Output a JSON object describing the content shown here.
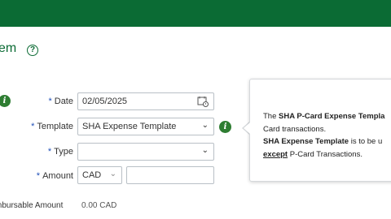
{
  "header": {
    "color": "#0b6b34"
  },
  "page": {
    "title": "em",
    "help_icon": "?"
  },
  "form": {
    "info_icon": "i",
    "date": {
      "required": "*",
      "label": "Date",
      "value": "02/05/2025"
    },
    "template": {
      "required": "*",
      "label": "Template",
      "value": "SHA Expense Template"
    },
    "type": {
      "required": "*",
      "label": "Type",
      "value": ""
    },
    "amount": {
      "required": "*",
      "label": "Amount",
      "currency": "CAD",
      "value": ""
    },
    "reimbursable": {
      "label": "mbursable Amount",
      "value": "0.00 CAD"
    }
  },
  "popup": {
    "line1_pre": "The ",
    "line1_bold": "SHA P-Card Expense Templa",
    "line2": "Card transactions.",
    "line3_bold": "SHA Expense Template",
    "line3_rest": " is to be u",
    "line4_underline": "except",
    "line4_rest": " P-Card Transactions."
  }
}
